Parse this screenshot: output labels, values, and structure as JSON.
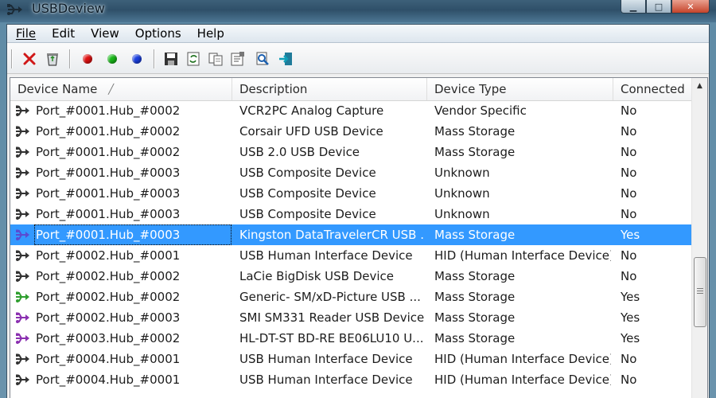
{
  "window": {
    "title": "USBDeview"
  },
  "menu": [
    "File",
    "Edit",
    "View",
    "Options",
    "Help"
  ],
  "toolbar": {
    "icons": [
      "delete-icon",
      "recycle-icon",
      "red-dot-icon",
      "green-dot-icon",
      "blue-dot-icon",
      "save-icon",
      "refresh-icon",
      "copy-icon",
      "properties-icon",
      "find-icon",
      "exit-icon"
    ]
  },
  "columns": [
    "Device Name",
    "Description",
    "Device Type",
    "Connected"
  ],
  "rows": [
    {
      "name": "Port_#0001.Hub_#0002",
      "description": "VCR2PC Analog Capture",
      "type": "Vendor Specific",
      "connected": "No",
      "icon_color": "#333333"
    },
    {
      "name": "Port_#0001.Hub_#0002",
      "description": "Corsair UFD USB Device",
      "type": "Mass Storage",
      "connected": "No",
      "icon_color": "#333333"
    },
    {
      "name": "Port_#0001.Hub_#0002",
      "description": "USB 2.0 USB Device",
      "type": "Mass Storage",
      "connected": "No",
      "icon_color": "#333333"
    },
    {
      "name": "Port_#0001.Hub_#0003",
      "description": "USB Composite Device",
      "type": "Unknown",
      "connected": "No",
      "icon_color": "#333333"
    },
    {
      "name": "Port_#0001.Hub_#0003",
      "description": "USB Composite Device",
      "type": "Unknown",
      "connected": "No",
      "icon_color": "#333333"
    },
    {
      "name": "Port_#0001.Hub_#0003",
      "description": "USB Composite Device",
      "type": "Unknown",
      "connected": "No",
      "icon_color": "#333333"
    },
    {
      "name": "Port_#0001.Hub_#0003",
      "description": "Kingston DataTravelerCR USB ...",
      "type": "Mass Storage",
      "connected": "Yes",
      "icon_color": "#5a4bd1",
      "selected": true
    },
    {
      "name": "Port_#0002.Hub_#0001",
      "description": "USB Human Interface Device",
      "type": "HID (Human Interface Device)",
      "connected": "No",
      "icon_color": "#333333"
    },
    {
      "name": "Port_#0002.Hub_#0002",
      "description": "LaCie BigDisk USB Device",
      "type": "Mass Storage",
      "connected": "No",
      "icon_color": "#333333"
    },
    {
      "name": "Port_#0002.Hub_#0002",
      "description": "Generic- SM/xD-Picture USB ...",
      "type": "Mass Storage",
      "connected": "Yes",
      "icon_color": "#2e9e2e"
    },
    {
      "name": "Port_#0002.Hub_#0003",
      "description": "SMI SM331 Reader USB Device",
      "type": "Mass Storage",
      "connected": "Yes",
      "icon_color": "#8a2fb0"
    },
    {
      "name": "Port_#0003.Hub_#0002",
      "description": "HL-DT-ST BD-RE  BE06LU10 U...",
      "type": "Mass Storage",
      "connected": "Yes",
      "icon_color": "#8a2fb0"
    },
    {
      "name": "Port_#0004.Hub_#0001",
      "description": "USB Human Interface Device",
      "type": "HID (Human Interface Device)",
      "connected": "No",
      "icon_color": "#333333"
    },
    {
      "name": "Port_#0004.Hub_#0001",
      "description": "USB Human Interface Device",
      "type": "HID (Human Interface Device)",
      "connected": "No",
      "icon_color": "#333333"
    }
  ],
  "colors": {
    "selection": "#3399ff",
    "red_dot": "#e01010",
    "green_dot": "#18b818",
    "blue_dot": "#1a3fe0"
  }
}
